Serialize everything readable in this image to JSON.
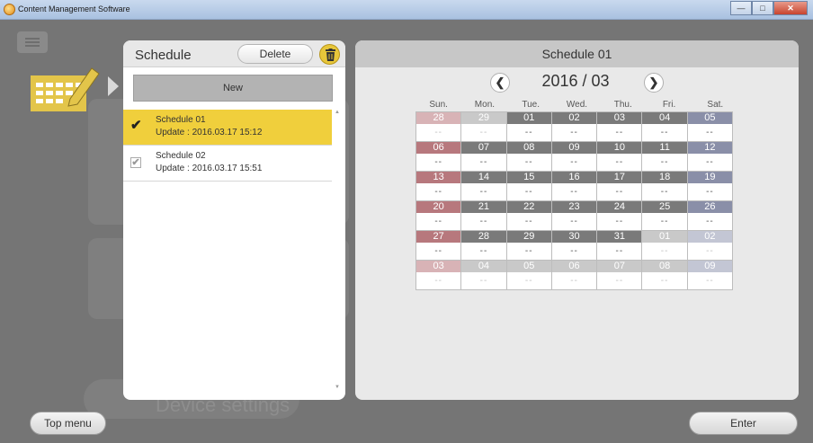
{
  "window": {
    "title": "Content Management Software"
  },
  "background": {
    "device_settings": "Device settings"
  },
  "footer": {
    "top_menu": "Top menu",
    "enter": "Enter"
  },
  "list": {
    "title": "Schedule",
    "delete_label": "Delete",
    "new_label": "New",
    "items": [
      {
        "name": "Schedule 01",
        "update": "Update : 2016.03.17  15:12",
        "selected": true
      },
      {
        "name": "Schedule 02",
        "update": "Update : 2016.03.17  15:51",
        "selected": false
      }
    ]
  },
  "calendar": {
    "title": "Schedule 01",
    "month": "2016 / 03",
    "weekdays": [
      "Sun.",
      "Mon.",
      "Tue.",
      "Wed.",
      "Thu.",
      "Fri.",
      "Sat."
    ],
    "weeks": [
      [
        "28",
        "29",
        "01",
        "02",
        "03",
        "04",
        "05"
      ],
      [
        "06",
        "07",
        "08",
        "09",
        "10",
        "11",
        "12"
      ],
      [
        "13",
        "14",
        "15",
        "16",
        "17",
        "18",
        "19"
      ],
      [
        "20",
        "21",
        "22",
        "23",
        "24",
        "25",
        "26"
      ],
      [
        "27",
        "28",
        "29",
        "30",
        "31",
        "01",
        "02"
      ],
      [
        "03",
        "04",
        "05",
        "06",
        "07",
        "08",
        "09"
      ]
    ],
    "empty_value": "--",
    "colors": {
      "sunday": "#b7787d",
      "saturday": "#8a8fa8",
      "weekday": "#7a7a7a",
      "selected_item": "#f0cf3c"
    }
  }
}
